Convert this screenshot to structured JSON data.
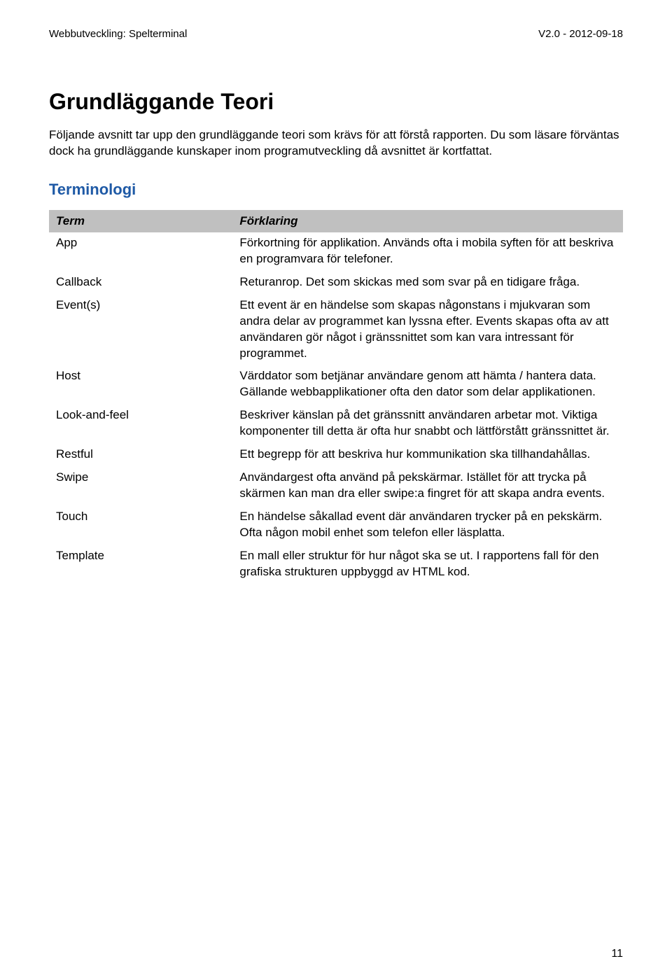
{
  "header": {
    "left": "Webbutveckling: Spelterminal",
    "right": "V2.0 - 2012-09-18"
  },
  "title": "Grundläggande Teori",
  "intro": "Följande avsnitt tar upp den grundläggande teori som krävs för att förstå rapporten. Du som läsare förväntas dock ha grundläggande kunskaper inom programutveckling då avsnittet är kortfattat.",
  "section_heading": "Terminologi",
  "table": {
    "headers": [
      "Term",
      "Förklaring"
    ],
    "rows": [
      {
        "term": "App",
        "def": "Förkortning för applikation. Används ofta i mobila syften för att beskriva en programvara för telefoner."
      },
      {
        "term": "Callback",
        "def": "Returanrop. Det som skickas med som svar på en tidigare fråga."
      },
      {
        "term": "Event(s)",
        "def": "Ett event är en händelse som skapas någonstans i mjukvaran som andra delar av programmet kan lyssna efter. Events skapas ofta av att användaren gör något i gränssnittet som kan vara intressant för programmet."
      },
      {
        "term": "Host",
        "def": "Värddator som betjänar användare genom att hämta / hantera data. Gällande webbapplikationer ofta den dator som delar applikationen."
      },
      {
        "term": "Look-and-feel",
        "def": "Beskriver känslan på det gränssnitt användaren arbetar mot. Viktiga komponenter till detta är ofta hur snabbt och lättförstått gränssnittet är."
      },
      {
        "term": "Restful",
        "def": "Ett begrepp för att beskriva hur kommunikation ska tillhandahållas."
      },
      {
        "term": "Swipe",
        "def": "Användargest ofta använd på pekskärmar. Istället för att trycka på skärmen kan man dra eller swipe:a fingret för att skapa andra events."
      },
      {
        "term": "Touch",
        "def": "En händelse såkallad event där användaren trycker på en pekskärm. Ofta någon mobil enhet som telefon eller läsplatta."
      },
      {
        "term": "Template",
        "def": "En mall eller struktur för hur något ska se ut. I rapportens fall för den grafiska strukturen uppbyggd av HTML kod."
      }
    ]
  },
  "page_number": "11"
}
